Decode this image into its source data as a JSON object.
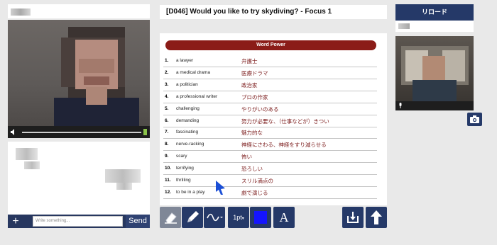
{
  "lesson": {
    "title": "[D046] Would you like to try skydiving? - Focus 1"
  },
  "word_power": {
    "header": "Word Power",
    "items": [
      {
        "num": "1.",
        "en": "a lawyer",
        "ja": "弁護士"
      },
      {
        "num": "2.",
        "en": "a medical drama",
        "ja": "医療ドラマ"
      },
      {
        "num": "3.",
        "en": "a politician",
        "ja": "政治家"
      },
      {
        "num": "4.",
        "en": "a professional writer",
        "ja": "プロの作家"
      },
      {
        "num": "5.",
        "en": "challenging",
        "ja": "やりがいのある"
      },
      {
        "num": "6.",
        "en": "demanding",
        "ja": "努力が必要な、（仕事などが）きつい"
      },
      {
        "num": "7.",
        "en": "fascinating",
        "ja": "魅力的な"
      },
      {
        "num": "8.",
        "en": "nerve-racking",
        "ja": "神経にさわる、神経をすり減らせる"
      },
      {
        "num": "9.",
        "en": "scary",
        "ja": "怖い"
      },
      {
        "num": "10.",
        "en": "terrifying",
        "ja": "恐ろしい"
      },
      {
        "num": "11.",
        "en": "thrilling",
        "ja": "スリル満点の"
      },
      {
        "num": "12.",
        "en": "to be in a play",
        "ja": "劇で演じる"
      }
    ]
  },
  "chat": {
    "placeholder": "Write something...",
    "send_label": "Send",
    "add_label": "+"
  },
  "toolbar": {
    "stroke_size": "1pt",
    "text_tool": "A",
    "active_color": "#1414ff",
    "icons": [
      "eraser-icon",
      "pencil-icon",
      "wave-line-icon",
      "stroke-size",
      "color-swatch",
      "text-icon",
      "download-icon",
      "upload-arrow-icon"
    ]
  },
  "right": {
    "reload_label": "リロード"
  },
  "colors": {
    "navy": "#253968",
    "header_red": "#8b1c18",
    "japanese_text": "#7b1b1b"
  }
}
